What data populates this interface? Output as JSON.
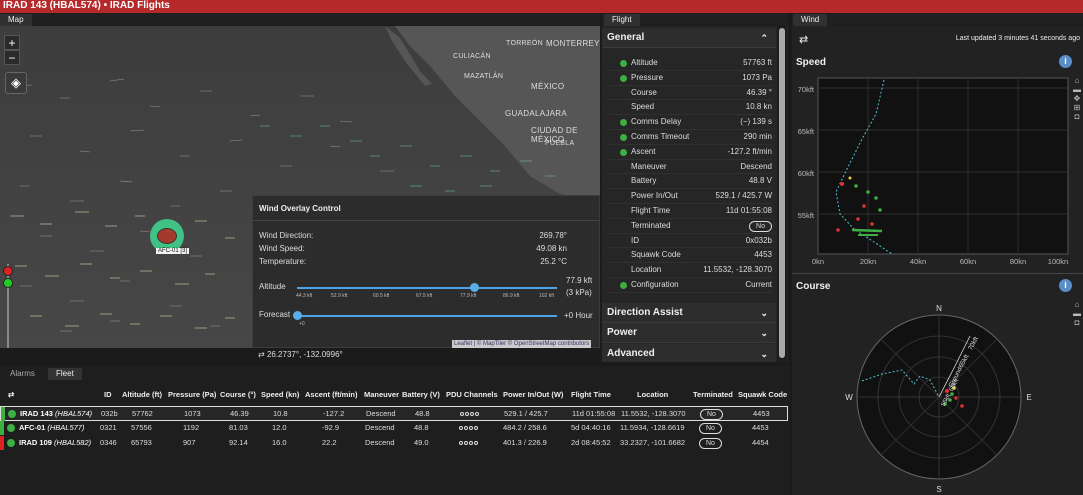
{
  "app_title": "IRAD 143 (HBAL574) • IRAD Flights",
  "tabs": {
    "map": "Map",
    "flight": "Flight",
    "wind": "Wind"
  },
  "map": {
    "zoom_in": "+",
    "zoom_out": "−",
    "cities": [
      "TORREÓN",
      "MONTERREY",
      "CULIACÁN",
      "MAZATLÁN",
      "MÉXICO",
      "GUADALAJARA",
      "CIUDAD DE MÉXICO",
      "PUEBLA"
    ],
    "balloon_label": "AFC-01 [3]",
    "coords": "26.2737°, -132.0996°",
    "attribution": "Leaflet | © MapTiler © OpenStreetMap contributors",
    "wind_overlay": {
      "title": "Wind Overlay Control",
      "direction_label": "Wind Direction:",
      "direction_value": "269.78°",
      "speed_label": "Wind Speed:",
      "speed_value": "49.08 kn",
      "temp_label": "Temperature:",
      "temp_value": "25.2 °C",
      "altitude_label": "Altitude",
      "altitude_ticks": [
        "44.3 kft",
        "52.9 kft",
        "60.5 kft",
        "67.5 kft",
        "77.9 kft",
        "86.9 kft",
        "102 kft"
      ],
      "altitude_value": "77.9 kft",
      "altitude_pressure": "(3 kPa)",
      "altitude_fraction": 0.68,
      "forecast_label": "Forecast",
      "forecast_tick": "+0",
      "forecast_value": "+0 Hour",
      "forecast_fraction": 0.0
    }
  },
  "flight": {
    "general_title": "General",
    "rows": [
      {
        "label": "Altitude",
        "value": "57763 ft",
        "ok": true
      },
      {
        "label": "Pressure",
        "value": "1073 Pa",
        "ok": true
      },
      {
        "label": "Course",
        "value": "46.39 °",
        "ok": false
      },
      {
        "label": "Speed",
        "value": "10.8 kn",
        "ok": false
      },
      {
        "label": "Comms Delay",
        "value": "(−) 139 s",
        "ok": true
      },
      {
        "label": "Comms Timeout",
        "value": "290 min",
        "ok": true
      },
      {
        "label": "Ascent",
        "value": "-127.2 ft/min",
        "ok": true
      },
      {
        "label": "Maneuver",
        "value": "Descend",
        "ok": false
      },
      {
        "label": "Battery",
        "value": "48.8 V",
        "ok": false
      },
      {
        "label": "Power In/Out",
        "value": "529.1 / 425.7 W",
        "ok": false
      },
      {
        "label": "Flight Time",
        "value": "11d 01:55:08",
        "ok": false
      },
      {
        "label": "Terminated",
        "value": "No",
        "ok": false,
        "pill": true
      },
      {
        "label": "ID",
        "value": "0x032b",
        "ok": false
      },
      {
        "label": "Squawk Code",
        "value": "4453",
        "ok": false
      },
      {
        "label": "Location",
        "value": "11.5532, -128.3070",
        "ok": false
      },
      {
        "label": "Configuration",
        "value": "Current",
        "ok": true
      }
    ],
    "direction_assist": "Direction Assist",
    "power": "Power",
    "advanced": "Advanced"
  },
  "fleet": {
    "tabs": [
      "Alarms",
      "Fleet"
    ],
    "columns": [
      "ID",
      "Altitude (ft)",
      "Pressure (Pa)",
      "Course (°)",
      "Speed (kn)",
      "Ascent (ft/min)",
      "Maneuver",
      "Battery (V)",
      "PDU Channels",
      "Power In/Out (W)",
      "Flight Time",
      "Location",
      "Terminated",
      "Squawk Code"
    ],
    "rows": [
      {
        "name": "IRAD 143",
        "alias": "(HBAL574)",
        "id": "032b",
        "alt": "57762",
        "pres": "1073",
        "course": "46.39",
        "speed": "10.8",
        "ascent": "-127.2",
        "man": "Descend",
        "batt": "48.8",
        "pow": "529.1 / 425.7",
        "time": "11d 01:55:08",
        "loc": "11.5532, -128.3070",
        "term": "No",
        "sq": "4453"
      },
      {
        "name": "AFC-01",
        "alias": "(HBAL577)",
        "id": "0321",
        "alt": "57556",
        "pres": "1192",
        "course": "81.03",
        "speed": "12.0",
        "ascent": "-92.9",
        "man": "Descend",
        "batt": "48.8",
        "pow": "484.2 / 258.6",
        "time": "5d 04:40:16",
        "loc": "11.5934, -128.6619",
        "term": "No",
        "sq": "4453"
      },
      {
        "name": "IRAD 109",
        "alias": "(HBAL582)",
        "id": "0346",
        "alt": "65793",
        "pres": "907",
        "course": "92.14",
        "speed": "16.0",
        "ascent": "22.2",
        "man": "Descend",
        "batt": "49.0",
        "pow": "401.3 / 226.9",
        "time": "2d 08:45:52",
        "loc": "33.2327, -101.6682",
        "term": "No",
        "sq": "4454"
      }
    ]
  },
  "wind": {
    "last_updated": "Last updated 3 minutes 41 seconds ago",
    "speed_title": "Speed",
    "course_title": "Course",
    "speed_y_ticks": [
      "70kft",
      "65kft",
      "60kft",
      "55kft"
    ],
    "speed_x_ticks": [
      "0kn",
      "20kn",
      "40kn",
      "60kn",
      "80kn",
      "100kn"
    ],
    "compass": [
      "N",
      "E",
      "S",
      "W"
    ],
    "compass_ring_labels": [
      "Ground",
      "65kft",
      "70kft"
    ],
    "compass_ring_labels_inner": [
      "55kft",
      "60kft"
    ]
  },
  "colors": {
    "accent": "#b5292b",
    "ok": "#3cb043",
    "slider": "#4da3e8"
  }
}
